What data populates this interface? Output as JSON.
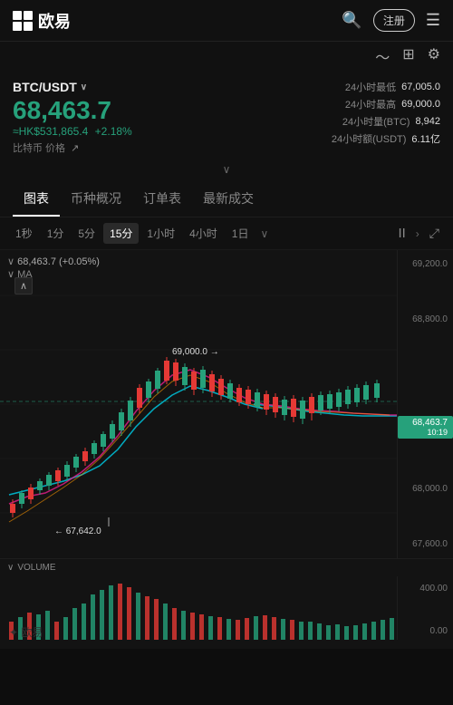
{
  "header": {
    "logo_text": "欧易",
    "search_icon": "🔍",
    "register_label": "注册",
    "menu_icon": "☰"
  },
  "ticker": {
    "symbol": "BTC/USDT",
    "price": "68,463.7",
    "hkd_equiv": "≈HK$531,865.4",
    "change_pct": "+2.18%",
    "label": "比特币 价格",
    "stats": [
      {
        "label": "24小时最低",
        "value": "67,005.0"
      },
      {
        "label": "24小时最高",
        "value": "69,000.0"
      },
      {
        "label": "24小时量(BTC)",
        "value": "8,942"
      },
      {
        "label": "24小时额(USDT)",
        "value": "6.11亿"
      }
    ]
  },
  "tabs": [
    "图表",
    "币种概况",
    "订单表",
    "最新成交"
  ],
  "active_tab": "图表",
  "timeframes": [
    "1秒",
    "1分",
    "5分",
    "15分",
    "1小时",
    "4小时",
    "1日"
  ],
  "active_timeframe": "15分",
  "chart": {
    "current_price_label": "68,463.7 (+0.05%)",
    "ma_label": "MA",
    "annotation_high": "69,000.0 →",
    "annotation_low": "← 67,642.0",
    "price_tag": "68,463.7",
    "time_tag": "10:19",
    "y_labels": [
      "69,200.0",
      "68,800.0",
      "",
      "68,463.7",
      "68,000.0",
      "67,600.0"
    ],
    "dashed_price": "68,463.7"
  },
  "volume": {
    "label": "VOLUME",
    "y_labels": [
      "400.00",
      "",
      "0.00"
    ]
  },
  "watermark": "✦ 欧易"
}
